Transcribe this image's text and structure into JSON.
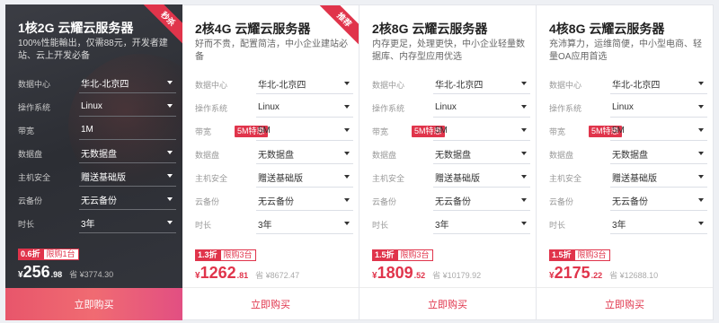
{
  "cards": [
    {
      "ribbon": "秒杀",
      "title": "1核2G 云耀云服务器",
      "desc": "100%性能輸出，仅需88元，开发者建站、云上开发必备",
      "rows": [
        {
          "label": "数据中心",
          "value": "华北-北京四",
          "dropdown": true
        },
        {
          "label": "操作系统",
          "value": "Linux",
          "dropdown": true
        },
        {
          "label": "带宽",
          "tag": "",
          "value": "1M",
          "dropdown": false
        },
        {
          "label": "数据盘",
          "value": "无数据盘",
          "dropdown": true
        },
        {
          "label": "主机安全",
          "value": "赠送基础版",
          "dropdown": true
        },
        {
          "label": "云备份",
          "value": "无云备份",
          "dropdown": true
        },
        {
          "label": "时长",
          "value": "3年",
          "dropdown": true
        }
      ],
      "discount": "0.6折",
      "limit": "限购1台",
      "price_int": "256",
      "price_dec": ".98",
      "orig_price": "¥3774.30",
      "buy": "立即购买"
    },
    {
      "ribbon": "推荐",
      "title": "2核4G 云耀云服务器",
      "desc": "好而不贵，配置简洁，中小企业建站必备",
      "rows": [
        {
          "label": "数据中心",
          "value": "华北-北京四",
          "dropdown": true
        },
        {
          "label": "操作系统",
          "value": "Linux",
          "dropdown": true
        },
        {
          "label": "带宽",
          "tag": "5M特惠",
          "value": "5M",
          "dropdown": true
        },
        {
          "label": "数据盘",
          "value": "无数据盘",
          "dropdown": true
        },
        {
          "label": "主机安全",
          "value": "赠送基础版",
          "dropdown": true
        },
        {
          "label": "云备份",
          "value": "无云备份",
          "dropdown": true
        },
        {
          "label": "时长",
          "value": "3年",
          "dropdown": true
        }
      ],
      "discount": "1.3折",
      "limit": "限购3台",
      "price_int": "1262",
      "price_dec": ".81",
      "orig_price": "¥8672.47",
      "buy": "立即购买"
    },
    {
      "ribbon": "",
      "title": "2核8G 云耀云服务器",
      "desc": "内存更足，处理更快，中小企业轻量数据库、内存型应用优选",
      "rows": [
        {
          "label": "数据中心",
          "value": "华北-北京四",
          "dropdown": true
        },
        {
          "label": "操作系统",
          "value": "Linux",
          "dropdown": true
        },
        {
          "label": "带宽",
          "tag": "5M特惠",
          "value": "5M",
          "dropdown": true
        },
        {
          "label": "数据盘",
          "value": "无数据盘",
          "dropdown": true
        },
        {
          "label": "主机安全",
          "value": "赠送基础版",
          "dropdown": true
        },
        {
          "label": "云备份",
          "value": "无云备份",
          "dropdown": true
        },
        {
          "label": "时长",
          "value": "3年",
          "dropdown": true
        }
      ],
      "discount": "1.5折",
      "limit": "限购3台",
      "price_int": "1809",
      "price_dec": ".52",
      "orig_price": "¥10179.92",
      "buy": "立即购买"
    },
    {
      "ribbon": "",
      "title": "4核8G 云耀云服务器",
      "desc": "充沛算力，运维简便，中小型电商、轻量OA应用首选",
      "rows": [
        {
          "label": "数据中心",
          "value": "华北-北京四",
          "dropdown": true
        },
        {
          "label": "操作系统",
          "value": "Linux",
          "dropdown": true
        },
        {
          "label": "带宽",
          "tag": "5M特惠",
          "value": "5M",
          "dropdown": true
        },
        {
          "label": "数据盘",
          "value": "无数据盘",
          "dropdown": true
        },
        {
          "label": "主机安全",
          "value": "赠送基础版",
          "dropdown": true
        },
        {
          "label": "云备份",
          "value": "无云备份",
          "dropdown": true
        },
        {
          "label": "时长",
          "value": "3年",
          "dropdown": true
        }
      ],
      "discount": "1.5折",
      "limit": "限购3台",
      "price_int": "2175",
      "price_dec": ".22",
      "orig_price": "¥12688.10",
      "buy": "立即购买"
    }
  ]
}
